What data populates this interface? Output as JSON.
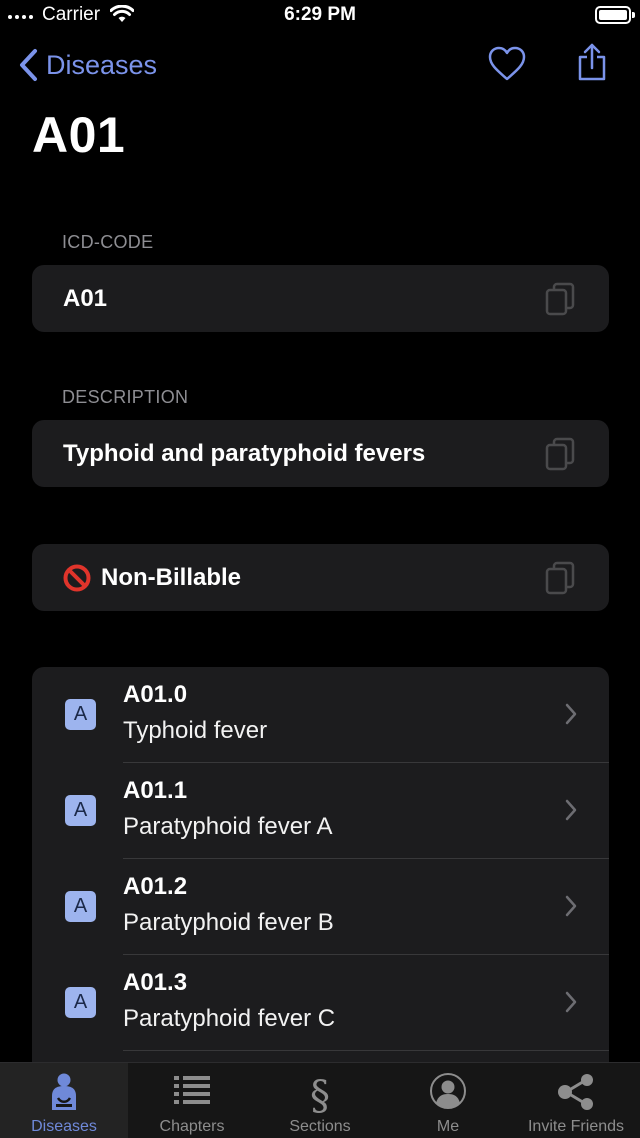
{
  "status_bar": {
    "carrier": "Carrier",
    "time": "6:29 PM",
    "battery_level": 1.0
  },
  "nav": {
    "back_label": "Diseases",
    "favorite_icon": "heart-icon",
    "share_icon": "share-icon"
  },
  "title": "A01",
  "icd_code": {
    "header": "ICD-CODE",
    "value": "A01"
  },
  "description": {
    "header": "DESCRIPTION",
    "value": "Typhoid and paratyphoid fevers"
  },
  "billable": {
    "icon": "no-entry-icon",
    "value": "Non-Billable"
  },
  "subcodes": [
    {
      "letter": "A",
      "code": "A01.0",
      "desc": "Typhoid fever"
    },
    {
      "letter": "A",
      "code": "A01.1",
      "desc": "Paratyphoid fever A"
    },
    {
      "letter": "A",
      "code": "A01.2",
      "desc": "Paratyphoid fever B"
    },
    {
      "letter": "A",
      "code": "A01.3",
      "desc": "Paratyphoid fever C"
    }
  ],
  "tabs": [
    {
      "label": "Diseases",
      "icon": "person-icon",
      "active": true
    },
    {
      "label": "Chapters",
      "icon": "list-icon",
      "active": false
    },
    {
      "label": "Sections",
      "icon": "section-icon",
      "active": false
    },
    {
      "label": "Me",
      "icon": "avatar-icon",
      "active": false
    },
    {
      "label": "Invite Friends",
      "icon": "share-network-icon",
      "active": false
    }
  ],
  "colors": {
    "accent": "#7b93ea",
    "background": "#000000",
    "card": "#1c1c1e",
    "badge": "#9db4ee"
  }
}
